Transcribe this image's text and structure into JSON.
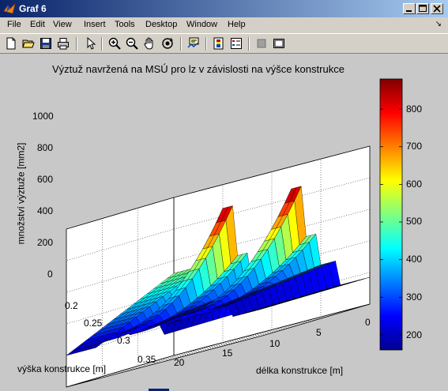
{
  "window": {
    "title": "Graf 6",
    "buttons": [
      "minimize",
      "maximize",
      "close"
    ]
  },
  "menubar": {
    "items": [
      "File",
      "Edit",
      "View",
      "Insert",
      "Tools",
      "Desktop",
      "Window",
      "Help"
    ],
    "dock_arrow": "↘"
  },
  "toolbar": {
    "icons": [
      "new-figure-icon",
      "open-icon",
      "save-icon",
      "print-icon",
      "pointer-icon",
      "zoom-in-icon",
      "zoom-out-icon",
      "pan-icon",
      "rotate3d-icon",
      "data-cursor-icon",
      "colorbar-icon",
      "legend-icon",
      "hide-plot-tools-icon",
      "show-plot-tools-icon"
    ]
  },
  "colors": {
    "titlebar_start": "#0a246a",
    "titlebar_end": "#a6caf0",
    "figure_bg": "#c8c8c8",
    "axes_bg": "#ffffff"
  },
  "chart_data": {
    "type": "surface",
    "title": "Výztuž navržená na MSÚ pro lz v závislosti na výšce konstrukce",
    "xlabel": "délka konstrukce [m]",
    "ylabel": "výška konstrukce [m]",
    "zlabel": "množství výztuže [mm2]",
    "x_ticks": [
      "0",
      "5",
      "10",
      "15",
      "20"
    ],
    "y_ticks": [
      "0.2",
      "0.25",
      "0.3",
      "0.35"
    ],
    "z_ticks": [
      "0",
      "200",
      "400",
      "600",
      "800",
      "1000"
    ],
    "xlim": [
      0,
      20
    ],
    "ylim": [
      0.2,
      0.35
    ],
    "zlim": [
      0,
      1000
    ],
    "grid": true,
    "colormap": "jet",
    "colorbar": {
      "ticks": [
        "200",
        "300",
        "400",
        "500",
        "600",
        "700",
        "800"
      ],
      "range": [
        160,
        880
      ]
    },
    "ridges": [
      {
        "x_center": 14.5,
        "peak_at_min_height": 850,
        "value_at_max_height": 250
      },
      {
        "x_center": 7.5,
        "peak_at_min_height": 860,
        "value_at_max_height": 260
      }
    ],
    "plateaus": [
      {
        "x_range": [
          17,
          20
        ],
        "value_at_min_height": 520,
        "value_at_max_height": 200
      },
      {
        "x_range": [
          10.5,
          12
        ],
        "value_at_min_height": 320,
        "value_at_max_height": 240
      },
      {
        "x_range": [
          3.5,
          5.5
        ],
        "value_at_min_height": 330,
        "value_at_max_height": 250
      }
    ],
    "base_value": 170
  }
}
